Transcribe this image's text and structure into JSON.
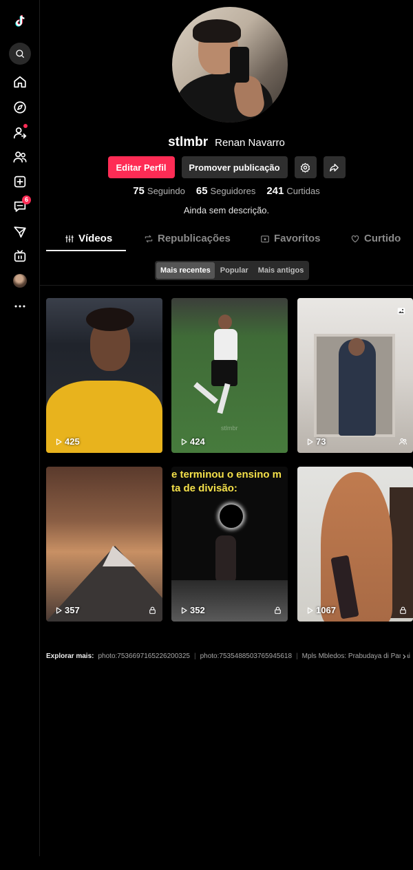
{
  "profile": {
    "username": "stlmbr",
    "nickname": "Renan Navarro",
    "bio": "Ainda sem descrição."
  },
  "sidebar": {
    "items": [
      {
        "icon": "tiktok-logo-icon"
      },
      {
        "icon": "search-icon"
      },
      {
        "icon": "home-icon"
      },
      {
        "icon": "explore-icon"
      },
      {
        "icon": "following-icon",
        "has_dot": true
      },
      {
        "icon": "friends-icon"
      },
      {
        "icon": "upload-icon"
      },
      {
        "icon": "messages-icon",
        "badge": "6"
      },
      {
        "icon": "activity-icon"
      },
      {
        "icon": "live-icon"
      },
      {
        "icon": "avatar"
      },
      {
        "icon": "more-icon"
      }
    ],
    "messages_badge": "6"
  },
  "actions": {
    "edit_profile": "Editar Perfil",
    "promote": "Promover publicação"
  },
  "stats": {
    "following_count": "75",
    "following_label": "Seguindo",
    "followers_count": "65",
    "followers_label": "Seguidores",
    "likes_count": "241",
    "likes_label": "Curtidas"
  },
  "tabs": [
    {
      "label": "Vídeos",
      "active": true
    },
    {
      "label": "Republicações"
    },
    {
      "label": "Favoritos"
    },
    {
      "label": "Curtido"
    }
  ],
  "sort": {
    "options": [
      "Mais recentes",
      "Popular",
      "Mais antigos"
    ],
    "selected": "Mais recentes"
  },
  "videos": [
    {
      "views": "425"
    },
    {
      "views": "424",
      "watermark": "stlmbr"
    },
    {
      "views": "73",
      "badge": "photo-icon",
      "visibility": "friends-icon"
    },
    {
      "views": "357",
      "visibility": "lock-icon"
    },
    {
      "views": "352",
      "caption": "e terminou o ensino m\nta de divisão:",
      "visibility": "lock-icon"
    },
    {
      "views": "1067",
      "visibility": "lock-icon"
    }
  ],
  "explore": {
    "label": "Explorar mais:",
    "links": [
      "photo:7536697165226200325",
      "photo:7535488503765945618",
      "Mpls Mbledos: Prabudaya di Pantai"
    ]
  },
  "colors": {
    "accent": "#fe2c55",
    "background": "#000000",
    "button_secondary": "#2f2f2f"
  }
}
